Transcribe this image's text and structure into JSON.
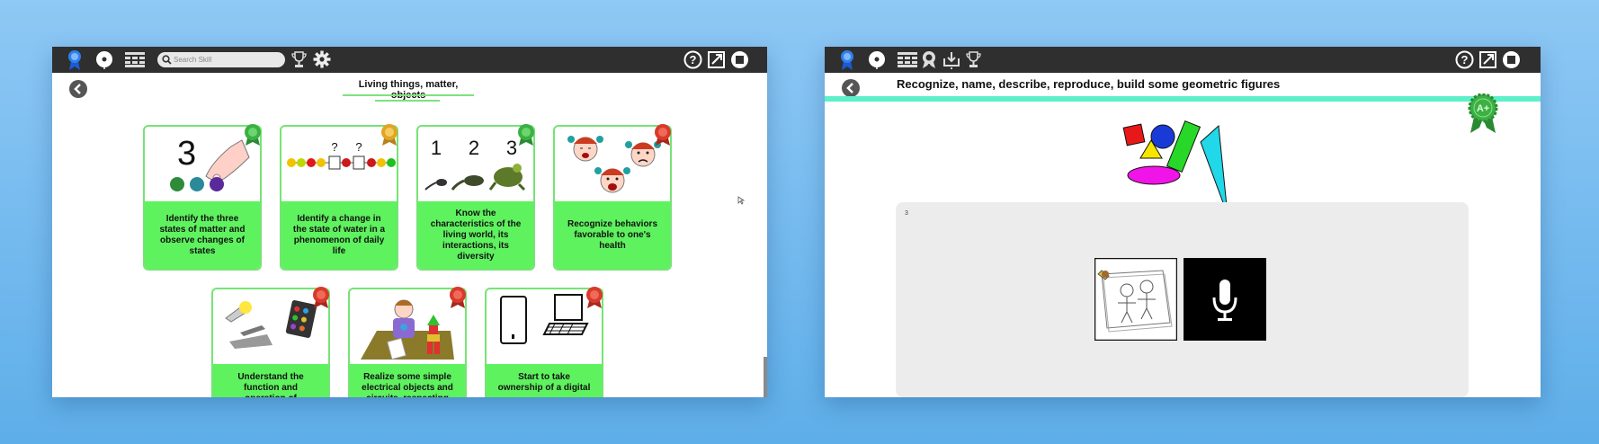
{
  "left_window": {
    "search": {
      "placeholder": "Search Skill",
      "value": ""
    },
    "title": "Living things, matter, objects",
    "cards": [
      {
        "label": "Identify the three states of matter and observe changes of states",
        "badge": "green"
      },
      {
        "label": "Identify a change in the state of water in a phenomenon of daily life",
        "badge": "gold"
      },
      {
        "label": "Know the characteristics of the living world, its interactions, its diversity",
        "badge": "green"
      },
      {
        "label": "Recognize behaviors favorable to one's health",
        "badge": "red"
      },
      {
        "label": "Understand the function and operation of manufactured",
        "badge": "red"
      },
      {
        "label": "Realize some simple electrical objects and circuits, respecting",
        "badge": "red"
      },
      {
        "label": "Start to take ownership of a digital",
        "badge": "red"
      }
    ],
    "art_text": {
      "number": "3",
      "question_marks": [
        "?",
        "?"
      ],
      "counting": [
        "1",
        "2",
        "3"
      ]
    }
  },
  "right_window": {
    "title": "Recognize, name, describe, reproduce, build some geometric figures",
    "grade_badge": "A+",
    "panel_number": "3",
    "tiles": [
      "drawing",
      "microphone"
    ]
  },
  "colors": {
    "toolbar": "#2f2f2f",
    "card_green": "#5ef25e",
    "card_border": "#76e376",
    "band": "#5ef0c8",
    "badge_green": "#3cb043",
    "badge_gold": "#e0a526",
    "badge_red": "#d93a2b"
  }
}
